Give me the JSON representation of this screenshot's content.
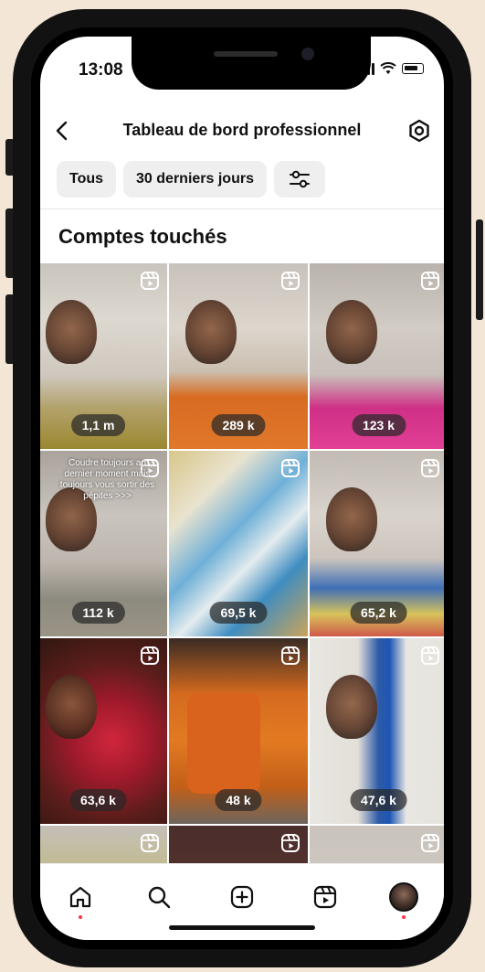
{
  "status_bar": {
    "time": "13:08"
  },
  "header": {
    "title": "Tableau de bord professionnel"
  },
  "filters": {
    "all_label": "Tous",
    "period_label": "30 derniers jours"
  },
  "section": {
    "title": "Comptes touchés"
  },
  "posts": [
    {
      "reach": "1,1 m"
    },
    {
      "reach": "289 k"
    },
    {
      "reach": "123 k"
    },
    {
      "reach": "112 k",
      "overlay": "Coudre toujours au dernier moment mais toujours vous sortir des pépites >>>"
    },
    {
      "reach": "69,5 k"
    },
    {
      "reach": "65,2 k"
    },
    {
      "reach": "63,6 k"
    },
    {
      "reach": "48 k"
    },
    {
      "reach": "47,6 k"
    },
    {
      "reach": ""
    },
    {
      "reach": ""
    },
    {
      "reach": ""
    }
  ],
  "nav": {
    "icons": [
      "home-icon",
      "search-icon",
      "create-icon",
      "reels-icon",
      "profile-avatar"
    ]
  }
}
